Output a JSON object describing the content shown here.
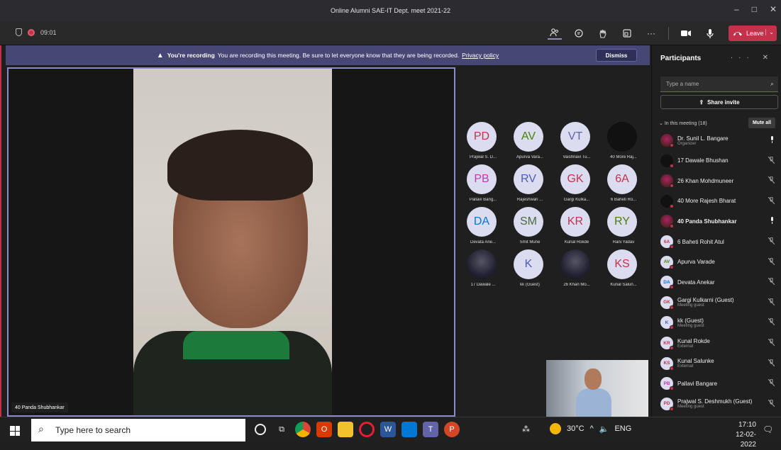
{
  "window": {
    "title": "Online Alumni SAE-IT Dept. meet 2021-22",
    "controls": [
      "–",
      "□",
      "✕"
    ]
  },
  "toolbar": {
    "timer": "09:01",
    "icons": [
      "people-icon",
      "chat-icon",
      "raise-hand-icon",
      "rooms-icon",
      "more-icon",
      "camera-icon",
      "mic-icon",
      "share-tray-icon"
    ],
    "more_label": "···",
    "leave_label": "Leave",
    "accent": "#c4314b"
  },
  "banner": {
    "title": "You're recording",
    "text": "You are recording this meeting. Be sure to let everyone know that they are being recorded.",
    "link": "Privacy policy",
    "dismiss": "Dismiss",
    "color": "#464775"
  },
  "main_video": {
    "name": "40 Panda Shubhankar"
  },
  "tiles": [
    {
      "initials": "PD",
      "name": "Prajwal S. D...",
      "kind": "initials"
    },
    {
      "initials": "AV",
      "name": "Apurva Vara...",
      "kind": "initials"
    },
    {
      "initials": "VT",
      "name": "Vaishnavi Tu...",
      "kind": "initials"
    },
    {
      "initials": "",
      "name": "40 More Raj...",
      "kind": "dark"
    },
    {
      "initials": "PB",
      "name": "Pallavi Bang...",
      "kind": "initials"
    },
    {
      "initials": "RV",
      "name": "Rajeshwari ...",
      "kind": "initials"
    },
    {
      "initials": "GK",
      "name": "Gargi Kulka...",
      "kind": "initials"
    },
    {
      "initials": "6A",
      "name": "6 Baheti Ro...",
      "kind": "initials"
    },
    {
      "initials": "DA",
      "name": "Devata Ane...",
      "kind": "initials"
    },
    {
      "initials": "SM",
      "name": "Smit Mune",
      "kind": "initials"
    },
    {
      "initials": "KR",
      "name": "Kunal Rokde",
      "kind": "initials"
    },
    {
      "initials": "RY",
      "name": "Rani Yadav",
      "kind": "initials"
    },
    {
      "initials": "",
      "name": "17 Dawale ...",
      "kind": "photo"
    },
    {
      "initials": "K",
      "name": "kk (Guest)",
      "kind": "initials"
    },
    {
      "initials": "",
      "name": "26 Khan Mo...",
      "kind": "photo"
    },
    {
      "initials": "KS",
      "name": "Kunal Salun...",
      "kind": "initials"
    }
  ],
  "tile_colors": {
    "PD": "#c4314b",
    "AV": "#498205",
    "VT": "#6264a7",
    "PB": "#c239b3",
    "RV": "#4a5bbf",
    "GK": "#c4314b",
    "6A": "#c4314b",
    "DA": "#0078d4",
    "SM": "#4b6b3c",
    "KR": "#c4314b",
    "RY": "#498205",
    "K": "#4a5bbf",
    "KS": "#c4314b"
  },
  "panel": {
    "title": "Participants",
    "controls": "··· ✕",
    "search_placeholder": "Type a name",
    "share_invite": "Share invite",
    "section": "In this meeting (18)",
    "mute_all": "Mute all",
    "participants": [
      {
        "av": "",
        "name": "Dr. Sunil L. Bangare",
        "sub": "Organizer",
        "kind": "photo",
        "mic": "on",
        "bold": false
      },
      {
        "av": "",
        "name": "17 Dawale Bhushan",
        "sub": "",
        "kind": "dark",
        "mic": "off",
        "bold": false
      },
      {
        "av": "",
        "name": "26 Khan Mohdmuneer",
        "sub": "",
        "kind": "photo",
        "mic": "off",
        "bold": false
      },
      {
        "av": "",
        "name": "40 More Rajesh Bharat",
        "sub": "",
        "kind": "dark",
        "mic": "off",
        "bold": false
      },
      {
        "av": "",
        "name": "40 Panda Shubhankar",
        "sub": "",
        "kind": "photo",
        "mic": "on",
        "bold": true
      },
      {
        "av": "6A",
        "name": "6 Baheti Rohit Atul",
        "sub": "",
        "kind": "initials",
        "mic": "off",
        "bold": false
      },
      {
        "av": "AV",
        "name": "Apurva Varade",
        "sub": "",
        "kind": "initials",
        "mic": "off",
        "bold": false
      },
      {
        "av": "DA",
        "name": "Devata Anekar",
        "sub": "",
        "kind": "initials",
        "mic": "off",
        "bold": false
      },
      {
        "av": "GK",
        "name": "Gargi Kulkarni (Guest)",
        "sub": "Meeting guest",
        "kind": "initials",
        "mic": "off",
        "bold": false
      },
      {
        "av": "K",
        "name": "kk (Guest)",
        "sub": "Meeting guest",
        "kind": "initials",
        "mic": "off",
        "bold": false
      },
      {
        "av": "KR",
        "name": "Kunal Rokde",
        "sub": "External",
        "kind": "initials",
        "mic": "off",
        "bold": false
      },
      {
        "av": "KS",
        "name": "Kunal Salunke",
        "sub": "External",
        "kind": "initials",
        "mic": "off",
        "bold": false
      },
      {
        "av": "PB",
        "name": "Pallavi Bangare",
        "sub": "",
        "kind": "initials",
        "mic": "off",
        "bold": false
      },
      {
        "av": "PD",
        "name": "Prajwal S. Deshmukh (Guest)",
        "sub": "Meeting guest",
        "kind": "initials",
        "mic": "off",
        "bold": false
      }
    ]
  },
  "taskbar": {
    "search_placeholder": "Type here to search",
    "apps": [
      "cortana-icon",
      "task-view-icon",
      "chrome-icon",
      "office-icon",
      "file-explorer-icon",
      "opera-icon",
      "word-icon",
      "photos-icon",
      "teams-icon",
      "powerpoint-icon"
    ],
    "temperature": "30°C",
    "language": "ENG",
    "time": "17:10",
    "date": "12-02-2022"
  }
}
